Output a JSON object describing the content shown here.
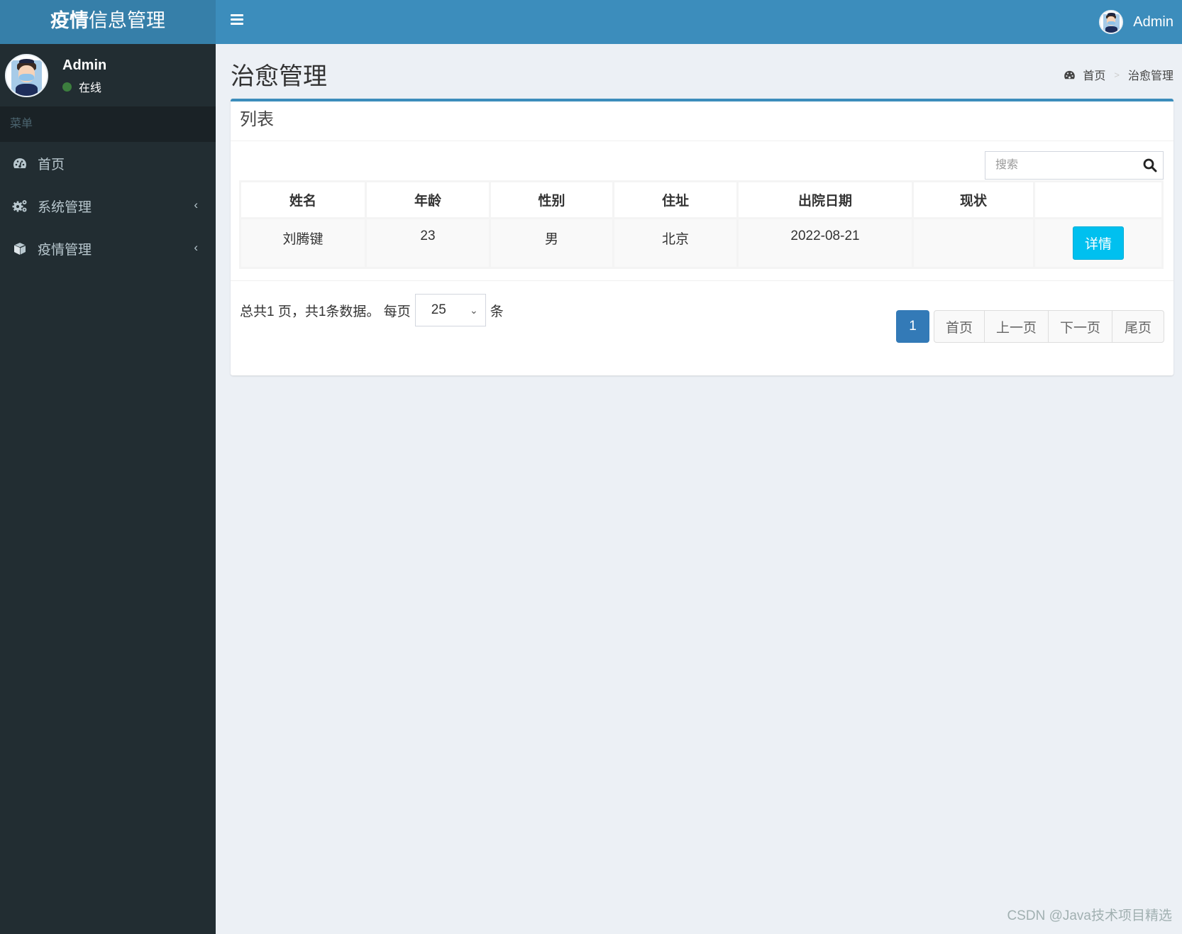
{
  "header": {
    "logo_bold": "疫情",
    "logo_rest": "信息管理",
    "user_name": "Admin"
  },
  "sidebar": {
    "user_name": "Admin",
    "status": "在线",
    "status_color": "#3c7e3e",
    "menu_header": "菜单",
    "items": [
      {
        "label": "首页",
        "icon": "dashboard-icon",
        "has_children": false
      },
      {
        "label": "系统管理",
        "icon": "cogs-icon",
        "has_children": true
      },
      {
        "label": "疫情管理",
        "icon": "cube-icon",
        "has_children": true
      }
    ]
  },
  "page": {
    "title": "治愈管理",
    "breadcrumb": {
      "home": "首页",
      "separator": ">",
      "current": "治愈管理"
    }
  },
  "box": {
    "title": "列表",
    "search_placeholder": "搜索",
    "table": {
      "columns": [
        "姓名",
        "年龄",
        "性别",
        "住址",
        "出院日期",
        "现状",
        ""
      ],
      "rows": [
        {
          "name": "刘腾键",
          "age": "23",
          "gender": "男",
          "address": "北京",
          "discharge_date": "2022-08-21",
          "status": "",
          "action": "详情"
        }
      ]
    },
    "pagination": {
      "summary": "总共1 页，共1条数据。 每页",
      "page_size": "25",
      "unit": "条",
      "current_page": "1",
      "first": "首页",
      "prev": "上一页",
      "next": "下一页",
      "last": "尾页"
    }
  },
  "colors": {
    "header": "#3c8dbc",
    "logo_bg": "#367fa9",
    "sidebar": "#222d32",
    "detail_button": "#00c0ef",
    "active_page": "#337ab7"
  },
  "watermark": "CSDN @Java技术项目精选"
}
